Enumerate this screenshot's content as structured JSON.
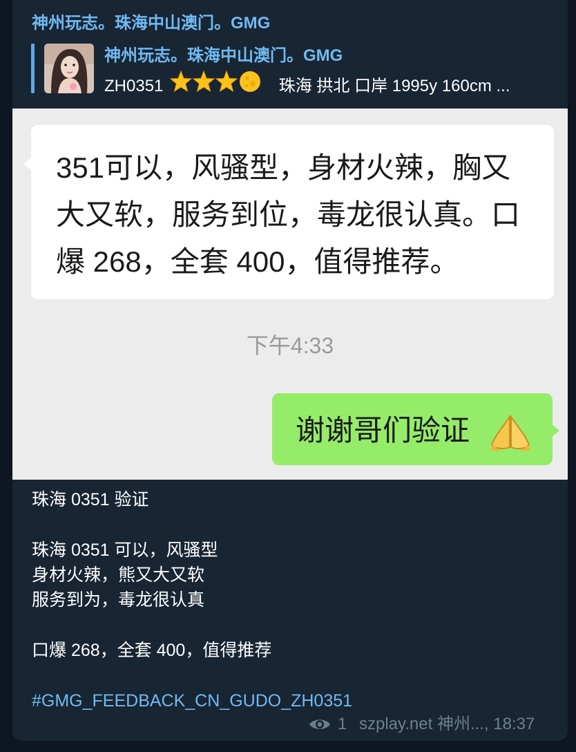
{
  "message": {
    "sender_name": "神州玩志。珠海中山澳门。GMG",
    "reply": {
      "title": "神州玩志。珠海中山澳门。GMG",
      "code": "ZH0351",
      "text": "珠海 拱北 口岸 1995y  160cm ..."
    },
    "screenshot": {
      "received_text": "351可以，风骚型，身材火辣，胸又大又软，服务到位，毒龙很认真。口爆 268，全套 400，值得推荐。",
      "time": "下午4:33",
      "sent_text": "谢谢哥们验证"
    },
    "caption": {
      "title": "珠海 0351 验证",
      "line1": "珠海 0351 可以，风骚型",
      "line2": "身材火辣，熊又大又软",
      "line3": "服务到为，毒龙很认真",
      "line4": "口爆 268，全套 400，值得推荐",
      "hashtag": "#GMG_FEEDBACK_CN_GUDO_ZH0351"
    },
    "footer": {
      "views": "1",
      "signature": "szplay.net 神州...,",
      "time": "18:37"
    }
  },
  "colors": {
    "background": "#0e1621",
    "bubble": "#182533",
    "accent_blue": "#71baf2",
    "wechat_green": "#95ec69",
    "meta_gray": "#6d7f8f"
  },
  "icons": [
    "star-icon",
    "half-moon-icon",
    "eye-icon",
    "pray-hands-icon"
  ]
}
